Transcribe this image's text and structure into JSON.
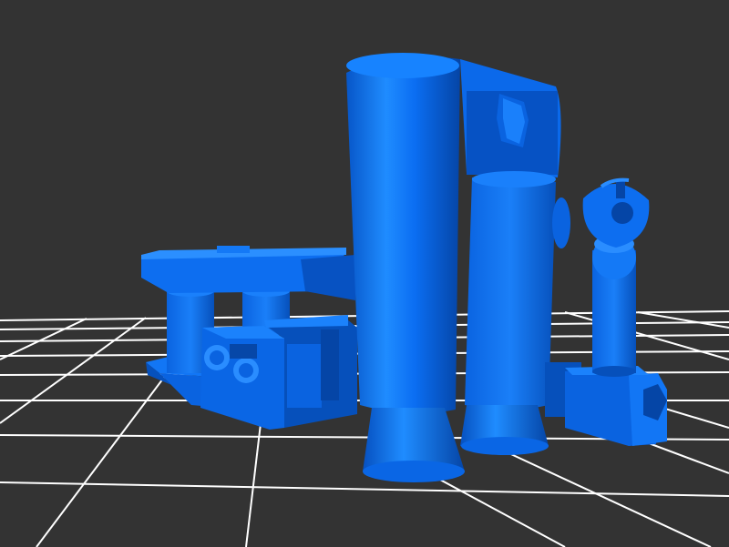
{
  "scene": {
    "background_color": "#333333",
    "grid_color": "#ffffff",
    "model_color": "#0a6cf0",
    "model_highlight": "#2b95ff",
    "model_shadow": "#0647a8"
  }
}
